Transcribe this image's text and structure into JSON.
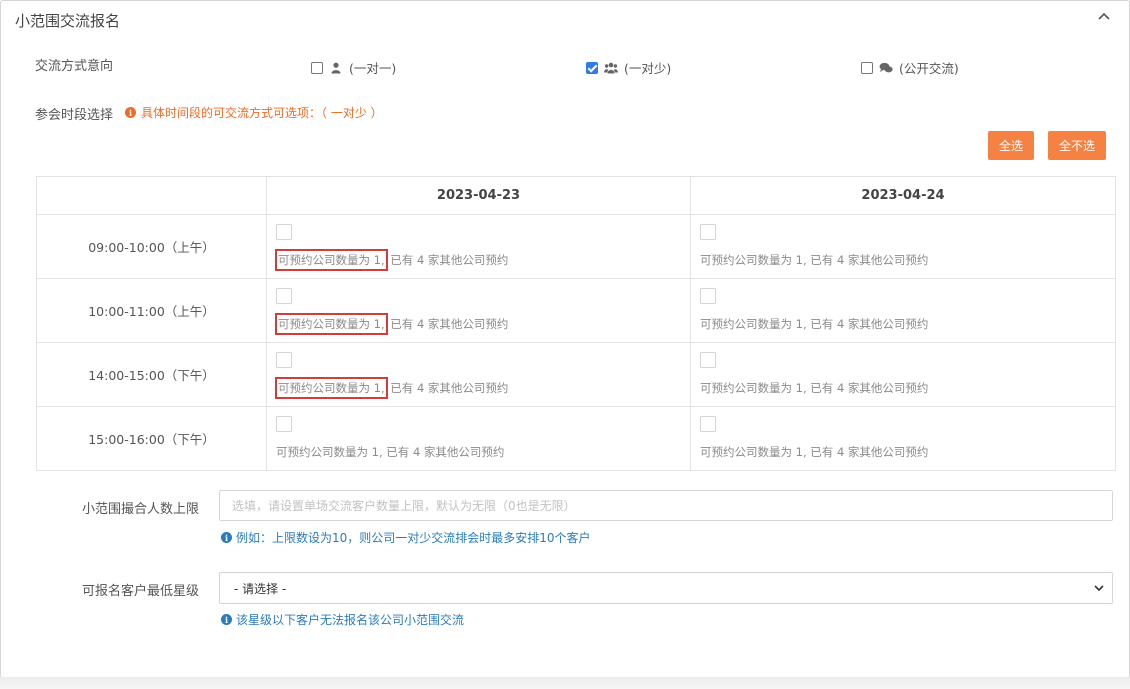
{
  "panel": {
    "title": "小范围交流报名"
  },
  "intent": {
    "label": "交流方式意向",
    "options": [
      {
        "text": "(一对一)",
        "checked": false,
        "icon": "user-icon"
      },
      {
        "text": "(一对少)",
        "checked": true,
        "icon": "users-icon"
      },
      {
        "text": "(公开交流)",
        "checked": false,
        "icon": "comments-icon"
      }
    ]
  },
  "session": {
    "label": "参会时段选择",
    "hint": "具体时间段的可交流方式可选项：（ 一对少 ）",
    "select_all": "全选",
    "select_none": "全不选"
  },
  "table": {
    "dates": [
      "2023-04-23",
      "2023-04-24"
    ],
    "rows": [
      {
        "time": "09:00-10:00（上午）",
        "cells": [
          {
            "quota": "可预约公司数量为 1,",
            "booked": " 已有 4 家其他公司预约"
          },
          {
            "quota": "可预约公司数量为 1,",
            "booked": " 已有 4 家其他公司预约"
          }
        ]
      },
      {
        "time": "10:00-11:00（上午）",
        "cells": [
          {
            "quota": "可预约公司数量为 1,",
            "booked": " 已有 4 家其他公司预约"
          },
          {
            "quota": "可预约公司数量为 1,",
            "booked": " 已有 4 家其他公司预约"
          }
        ]
      },
      {
        "time": "14:00-15:00（下午）",
        "cells": [
          {
            "quota": "可预约公司数量为 1,",
            "booked": " 已有 4 家其他公司预约"
          },
          {
            "quota": "可预约公司数量为 1,",
            "booked": " 已有 4 家其他公司预约"
          }
        ]
      },
      {
        "time": "15:00-16:00（下午）",
        "cells": [
          {
            "quota": "可预约公司数量为 1,",
            "booked": " 已有 4 家其他公司预约"
          },
          {
            "quota": "可预约公司数量为 1,",
            "booked": " 已有 4 家其他公司预约"
          }
        ]
      }
    ]
  },
  "limit": {
    "label": "小范围撮合人数上限",
    "placeholder": "选填，请设置单场交流客户数量上限，默认为无限（0也是无限）",
    "help": "例如：上限数设为10，则公司一对少交流排会时最多安排10个客户"
  },
  "star": {
    "label": "可报名客户最低星级",
    "selected": "- 请选择 -",
    "help": "该星级以下客户无法报名该公司小范围交流"
  },
  "colors": {
    "accent_orange": "#f58143",
    "hint_orange": "#f06a24",
    "help_blue": "#2a7bbf",
    "highlight_red": "#d63b3b",
    "check_blue": "#2d7be5"
  }
}
